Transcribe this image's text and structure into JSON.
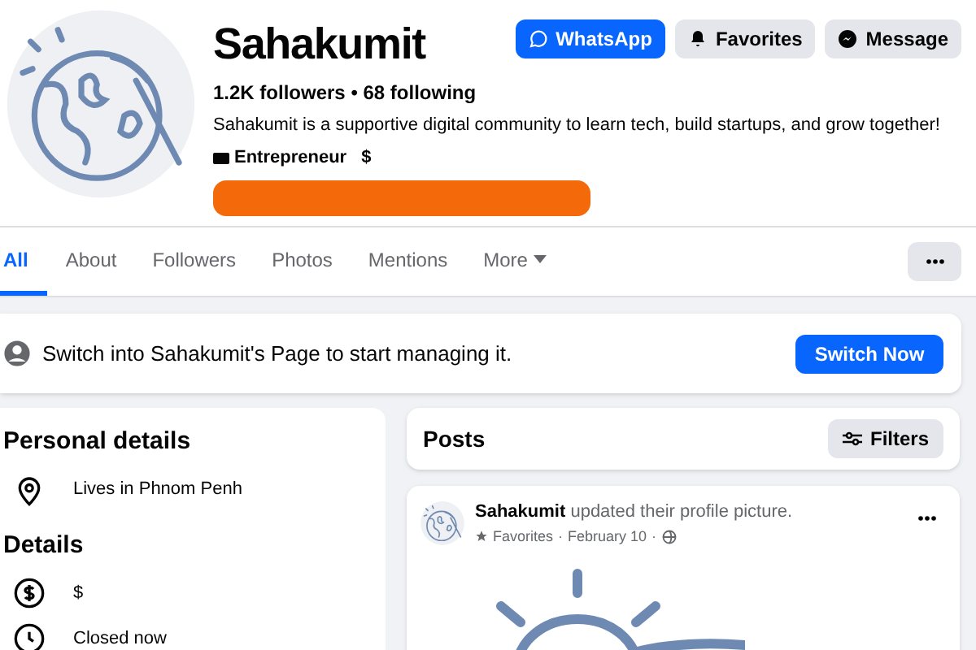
{
  "profile": {
    "name": "Sahakumit",
    "stats": "1.2K followers • 68 following",
    "bio": "Sahakumit is a supportive digital community to learn tech, build startups, and grow together!",
    "category": "Entrepreneur",
    "price": "$"
  },
  "actions": [
    {
      "label": "WhatsApp",
      "kind": "primary"
    },
    {
      "label": "Favorites",
      "kind": "secondary"
    },
    {
      "label": "Message",
      "kind": "secondary"
    }
  ],
  "tabs": [
    {
      "label": "All",
      "selected": true
    },
    {
      "label": "About",
      "selected": false
    },
    {
      "label": "Followers",
      "selected": false
    },
    {
      "label": "Photos",
      "selected": false
    },
    {
      "label": "Mentions",
      "selected": false
    },
    {
      "label": "More",
      "selected": false
    }
  ],
  "banner": {
    "text": "Switch into Sahakumit's Page to start managing it.",
    "button": "Switch Now"
  },
  "sidebar": {
    "sections": [
      {
        "title": "Personal details",
        "items": [
          {
            "kind": "location",
            "text": "Lives in Phnom Penh"
          }
        ]
      },
      {
        "title": "Details",
        "items": [
          {
            "kind": "price",
            "text": "$"
          },
          {
            "kind": "hours",
            "text": "Closed now"
          }
        ]
      }
    ]
  },
  "posts": {
    "title": "Posts",
    "filter": "Filters",
    "post": {
      "author": "Sahakumit",
      "action": "updated their profile picture.",
      "audience": "Favorites",
      "date": "February 10",
      "separator": "·"
    }
  }
}
